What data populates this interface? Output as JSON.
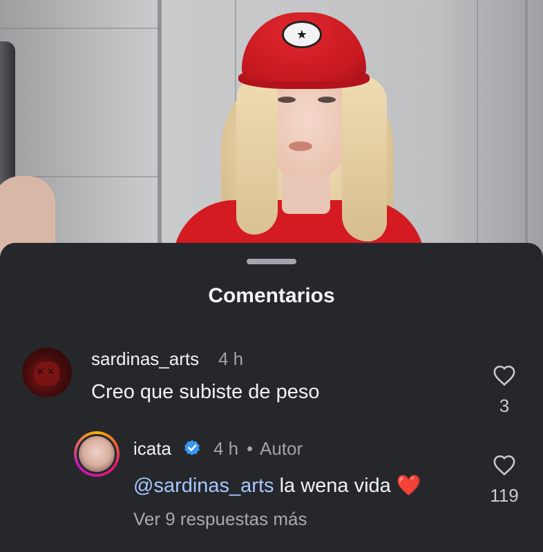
{
  "sheet": {
    "title": "Comentarios"
  },
  "comments": [
    {
      "username": "sardinas_arts",
      "time": "4 h",
      "text": "Creo que subiste de peso",
      "likes": "3",
      "avatar_icon": "red-skull-avatar"
    }
  ],
  "reply": {
    "username": "icata",
    "time": "4 h",
    "separator": "•",
    "author_badge": "Autor",
    "mention": "@sardinas_arts",
    "text": "la wena vida",
    "emoji": "❤️",
    "likes": "119",
    "verified_icon": "verified-badge-icon"
  },
  "replies_link": "Ver 9 respuestas más",
  "colors": {
    "sheet_bg": "#25272b",
    "mention": "#a8c7ff",
    "verified": "#3897f0",
    "heart_emoji": "#e8272b"
  }
}
